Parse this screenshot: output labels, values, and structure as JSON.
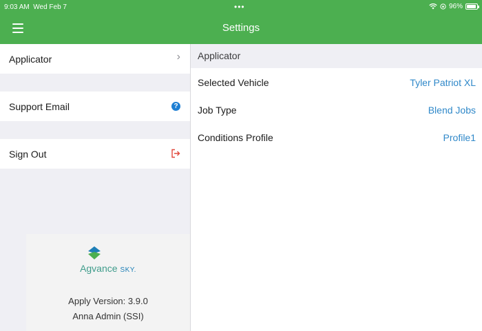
{
  "status_bar": {
    "time": "9:03 AM",
    "date": "Wed Feb 7",
    "dots": "•••",
    "battery": "96%",
    "battery_level": 0.96,
    "wifi_icon": "wifi-icon",
    "battery_icon": "battery-icon"
  },
  "nav": {
    "title": "Settings",
    "menu_icon": "hamburger-menu-icon"
  },
  "sidebar": {
    "items": [
      {
        "label": "Applicator",
        "icon": "chevron-right-icon",
        "glyph": "›"
      },
      {
        "label": "Support Email",
        "icon": "help-icon",
        "glyph": "?"
      },
      {
        "label": "Sign Out",
        "icon": "sign-out-icon"
      }
    ]
  },
  "brand": {
    "logo_name": "Agvance",
    "logo_suffix": "SKY.",
    "version": "Apply Version: 3.9.0",
    "user": "Anna Admin (SSI)"
  },
  "detail": {
    "section_title": "Applicator",
    "rows": [
      {
        "label": "Selected Vehicle",
        "value": "Tyler Patriot XL"
      },
      {
        "label": "Job Type",
        "value": "Blend Jobs"
      },
      {
        "label": "Conditions Profile",
        "value": "Profile1"
      }
    ]
  },
  "colors": {
    "header": "#4caf50",
    "link": "#2f88c9",
    "sign_out": "#e0483c",
    "help": "#1e7fd3",
    "sidebar_bg": "#efeff4"
  }
}
